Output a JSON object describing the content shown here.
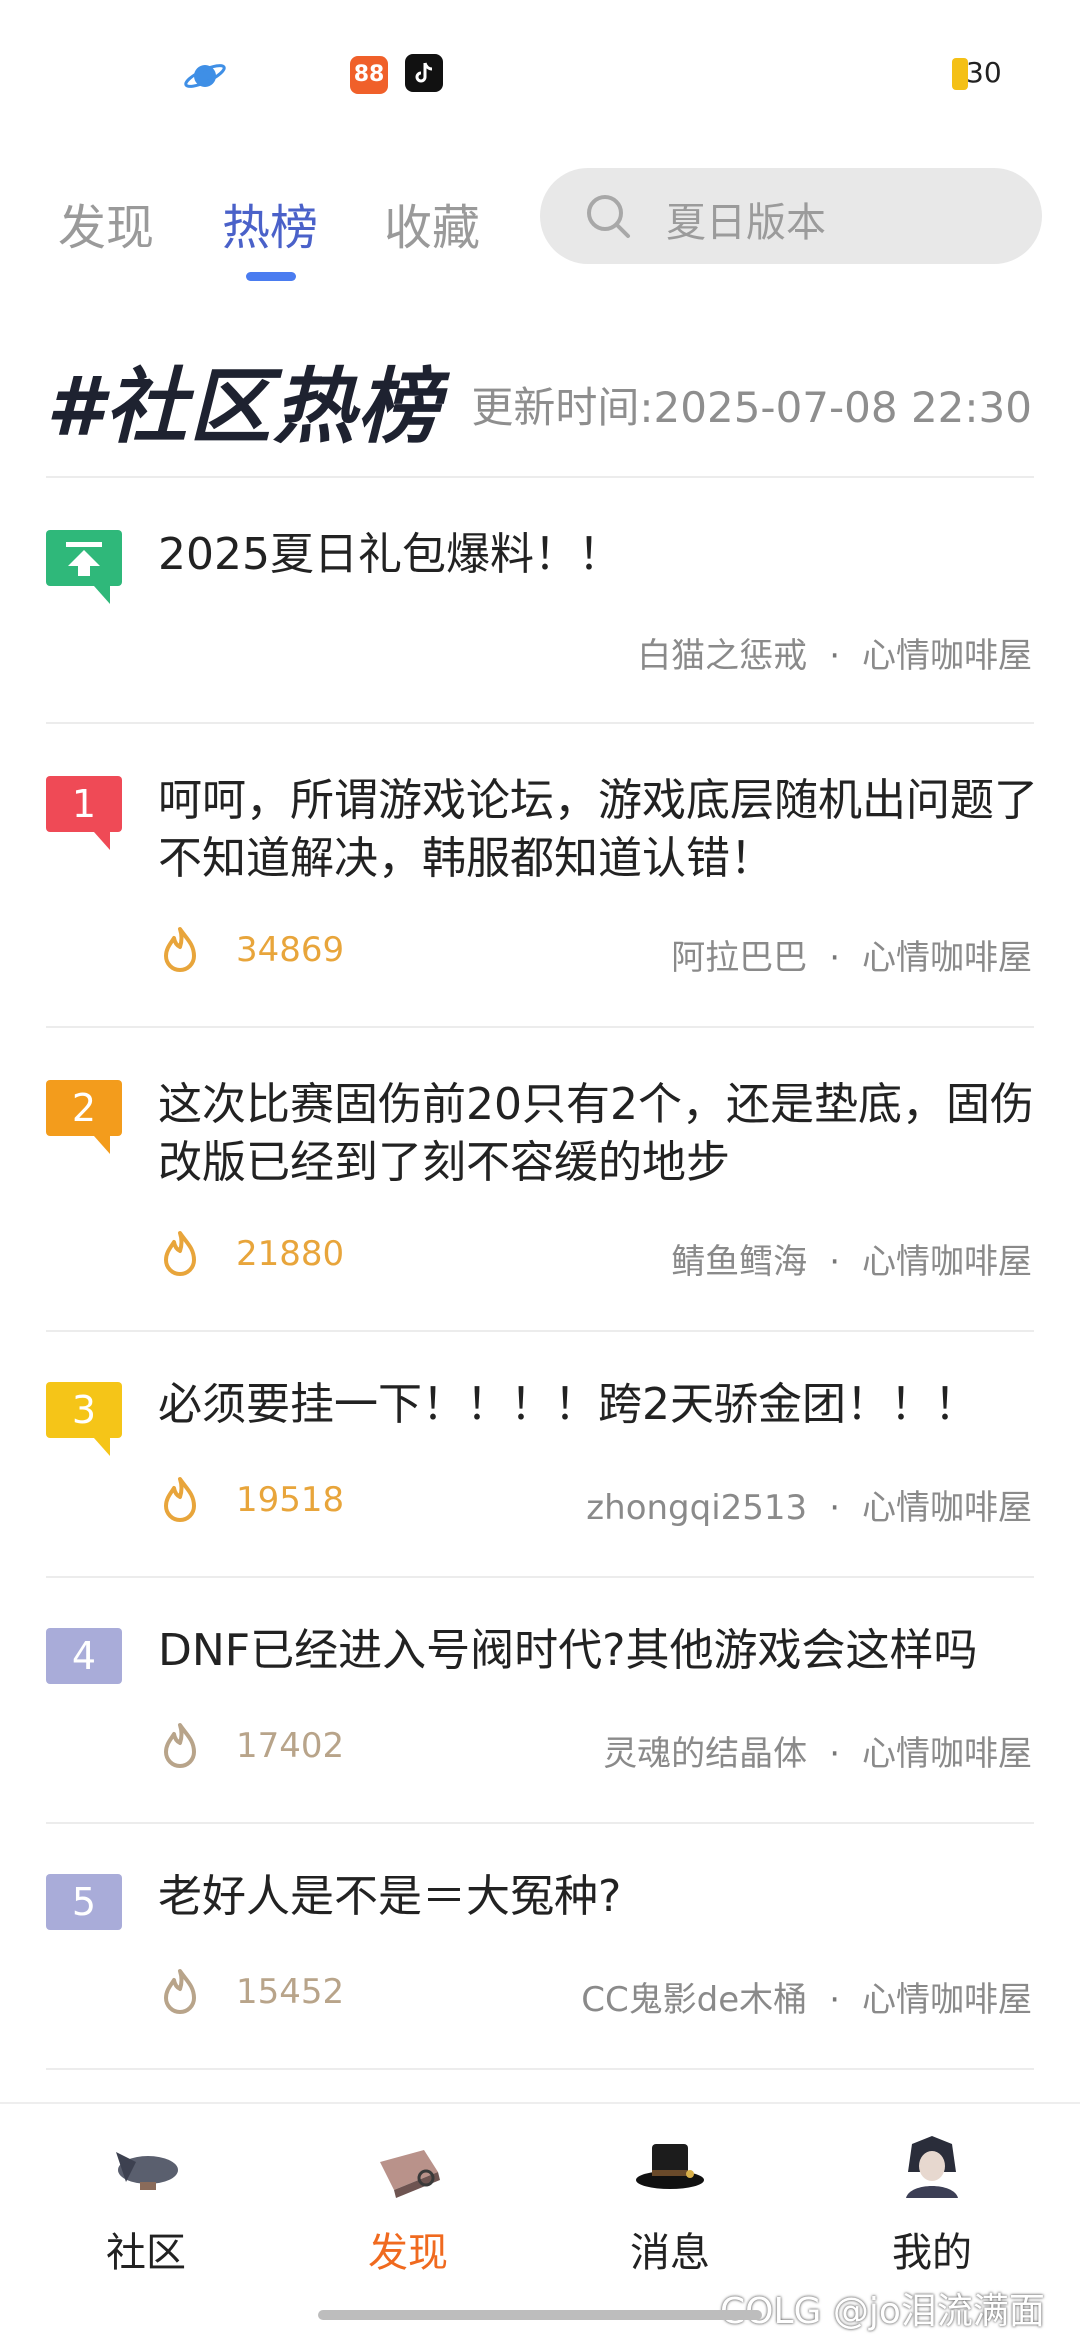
{
  "status_bar": {
    "battery": "30"
  },
  "top_tabs": [
    {
      "label": "发现",
      "active": false
    },
    {
      "label": "热榜",
      "active": true
    },
    {
      "label": "收藏",
      "active": false
    }
  ],
  "search": {
    "placeholder": "夏日版本"
  },
  "header": {
    "title": "#社区热榜",
    "update_time": "更新时间:2025-07-08 22:30"
  },
  "posts": [
    {
      "rank": "",
      "title": "2025夏日礼包爆料！！",
      "heat": "",
      "author": "白猫之惩戒",
      "board": "心情咖啡屋"
    },
    {
      "rank": "1",
      "title": "呵呵，所谓游戏论坛，游戏底层随机出问题了不知道解决，韩服都知道认错！",
      "heat": "34869",
      "author": "阿拉巴巴",
      "board": "心情咖啡屋"
    },
    {
      "rank": "2",
      "title": "这次比赛固伤前20只有2个，还是垫底，固伤改版已经到了刻不容缓的地步",
      "heat": "21880",
      "author": "鲭鱼鳕海",
      "board": "心情咖啡屋"
    },
    {
      "rank": "3",
      "title": "必须要挂一下！！！！跨2天骄金团！！！",
      "heat": "19518",
      "author": "zhongqi2513",
      "board": "心情咖啡屋"
    },
    {
      "rank": "4",
      "title": "DNF已经进入号阀时代?其他游戏会这样吗",
      "heat": "17402",
      "author": "灵魂的结晶体",
      "board": "心情咖啡屋"
    },
    {
      "rank": "5",
      "title": "老好人是不是＝大冤种?",
      "heat": "15452",
      "author": "CC鬼影de木桶",
      "board": "心情咖啡屋"
    }
  ],
  "meta_separator": "·",
  "bottom_nav": [
    {
      "label": "社区",
      "active": false
    },
    {
      "label": "发现",
      "active": true
    },
    {
      "label": "消息",
      "active": false
    },
    {
      "label": "我的",
      "active": false
    }
  ],
  "watermark": "COLG @jo泪流满面",
  "colors": {
    "accent_blue": "#4a61c9",
    "accent_orange": "#f06a1f",
    "rank1": "#ef4a56",
    "rank2": "#f39c1c",
    "rank3": "#f5c518",
    "rank_other": "#a9acd9",
    "pinned": "#2fb87a"
  }
}
